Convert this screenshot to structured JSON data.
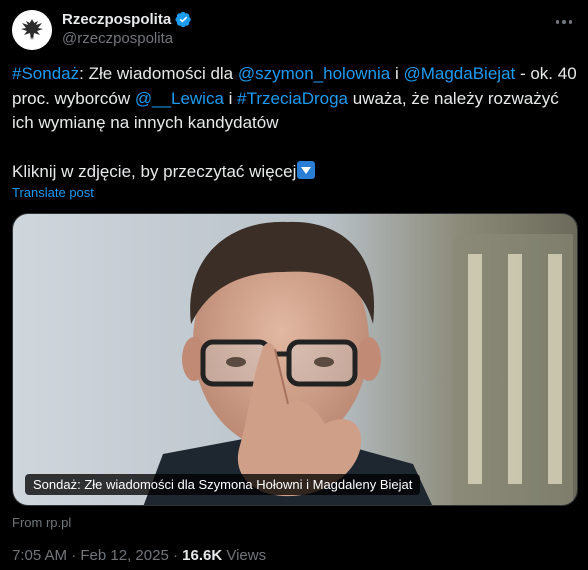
{
  "account": {
    "name": "Rzeczpospolita",
    "handle": "@rzeczpospolita",
    "verified": true
  },
  "tweet": {
    "parts": [
      {
        "text": "#Sondaż",
        "link": true
      },
      {
        "text": ": Złe wiadomości dla ",
        "link": false
      },
      {
        "text": "@szymon_holownia",
        "link": true
      },
      {
        "text": " i ",
        "link": false
      },
      {
        "text": "@MagdaBiejat",
        "link": true
      },
      {
        "text": " - ok. 40 proc. wyborców ",
        "link": false
      },
      {
        "text": "@__Lewica",
        "link": true
      },
      {
        "text": " i ",
        "link": false
      },
      {
        "text": "#TrzeciaDroga",
        "link": true
      },
      {
        "text": " uważa, że należy rozważyć ich wymianę na innych kandydatów",
        "link": false
      }
    ],
    "second_line": "Kliknij w zdjęcie, by przeczytać więcej",
    "translate_label": "Translate post"
  },
  "media": {
    "caption": "Sondaż: Złe wiadomości dla Szymona Hołowni i Magdaleny Biejat",
    "source": "From rp.pl"
  },
  "meta": {
    "time": "7:05 AM",
    "separator": " · ",
    "date": "Feb 12, 2025",
    "views_count": "16.6K",
    "views_label": " Views"
  },
  "colors": {
    "background": "#000000",
    "text": "#e7e9ea",
    "muted": "#71767b",
    "accent": "#1d9bf0"
  }
}
